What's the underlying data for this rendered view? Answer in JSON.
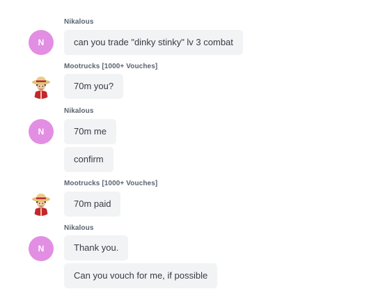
{
  "messages": [
    {
      "sender": "Nikalous",
      "avatar": {
        "type": "initial",
        "text": "N",
        "color": "#e28ee3"
      },
      "bubbles": [
        "can you trade \"dinky stinky\" lv 3 combat"
      ]
    },
    {
      "sender": "Mootrucks [1000+ Vouches]",
      "avatar": {
        "type": "image",
        "icon": "straw-hat-pirate-avatar"
      },
      "bubbles": [
        "70m you?"
      ]
    },
    {
      "sender": "Nikalous",
      "avatar": {
        "type": "initial",
        "text": "N",
        "color": "#e28ee3"
      },
      "bubbles": [
        "70m me",
        "confirm"
      ]
    },
    {
      "sender": "Mootrucks [1000+ Vouches]",
      "avatar": {
        "type": "image",
        "icon": "straw-hat-pirate-avatar"
      },
      "bubbles": [
        "70m paid"
      ]
    },
    {
      "sender": "Nikalous",
      "avatar": {
        "type": "initial",
        "text": "N",
        "color": "#e28ee3"
      },
      "bubbles": [
        "Thank you.",
        "Can you vouch for me, if possible"
      ]
    }
  ],
  "colors": {
    "bubble_bg": "#f2f3f5",
    "bubble_text": "#353b44",
    "name_text": "#5a6370",
    "initial_avatar_bg": "#e28ee3"
  }
}
